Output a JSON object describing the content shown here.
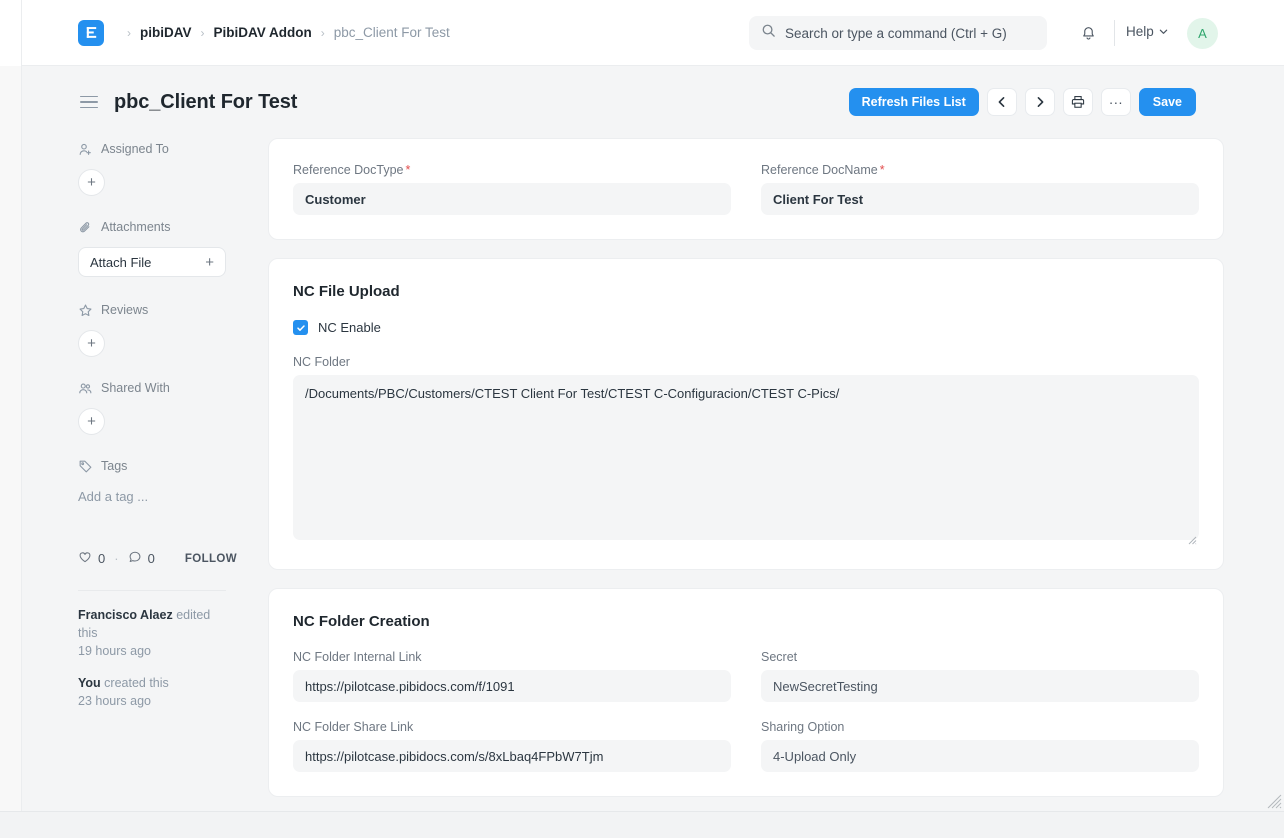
{
  "navbar": {
    "logo_alt": "frappe-logo",
    "breadcrumbs": [
      {
        "label": "pibiDAV"
      },
      {
        "label": "PibiDAV Addon"
      },
      {
        "label": "pbc_Client For Test"
      }
    ],
    "separator": "›",
    "search_placeholder": "Search or type a command (Ctrl + G)",
    "help_label": "Help",
    "avatar_initial": "A",
    "accent_color": "#2490ef"
  },
  "titlebar": {
    "title": "pbc_Client For Test",
    "refresh_label": "Refresh Files List",
    "prev_label": "‹",
    "next_label": "›",
    "print_label": "print-icon",
    "more_label": "···",
    "save_label": "Save"
  },
  "sidebar": {
    "assigned_to": {
      "label": "Assigned To",
      "add": "+"
    },
    "attachments": {
      "label": "Attachments",
      "button": "Attach File",
      "plus": "+"
    },
    "reviews": {
      "label": "Reviews",
      "add": "+"
    },
    "shared_with": {
      "label": "Shared With",
      "add": "+"
    },
    "tags": {
      "label": "Tags",
      "placeholder": "Add a tag ..."
    },
    "likes_count": "0",
    "comments_count": "0",
    "dot": "·",
    "follow_label": "FOLLOW",
    "activity": [
      {
        "who": "Francisco Alaez",
        "action": " edited this",
        "time": "19 hours ago"
      },
      {
        "who": "You",
        "action": " created this",
        "time": "23 hours ago"
      }
    ]
  },
  "form": {
    "reference_section": {
      "doctype": {
        "label": "Reference DocType",
        "required": "*",
        "value": "Customer"
      },
      "docname": {
        "label": "Reference DocName",
        "required": "*",
        "value": "Client For Test"
      }
    },
    "nc_file_upload": {
      "title": "NC File Upload",
      "nc_enable": {
        "label": "NC Enable",
        "checked": true
      },
      "nc_folder": {
        "label": "NC Folder",
        "value": "/Documents/PBC/Customers/CTEST Client For Test/CTEST C-Configuracion/CTEST C-Pics/"
      }
    },
    "nc_folder_creation": {
      "title": "NC Folder Creation",
      "internal_link": {
        "label": "NC Folder Internal Link",
        "value": "https://pilotcase.pibidocs.com/f/1091"
      },
      "secret": {
        "label": "Secret",
        "value": "NewSecretTesting"
      },
      "share_link": {
        "label": "NC Folder Share Link",
        "value": "https://pilotcase.pibidocs.com/s/8xLbaq4FPbW7Tjm"
      },
      "sharing_option": {
        "label": "Sharing Option",
        "value": "4-Upload Only"
      }
    }
  }
}
